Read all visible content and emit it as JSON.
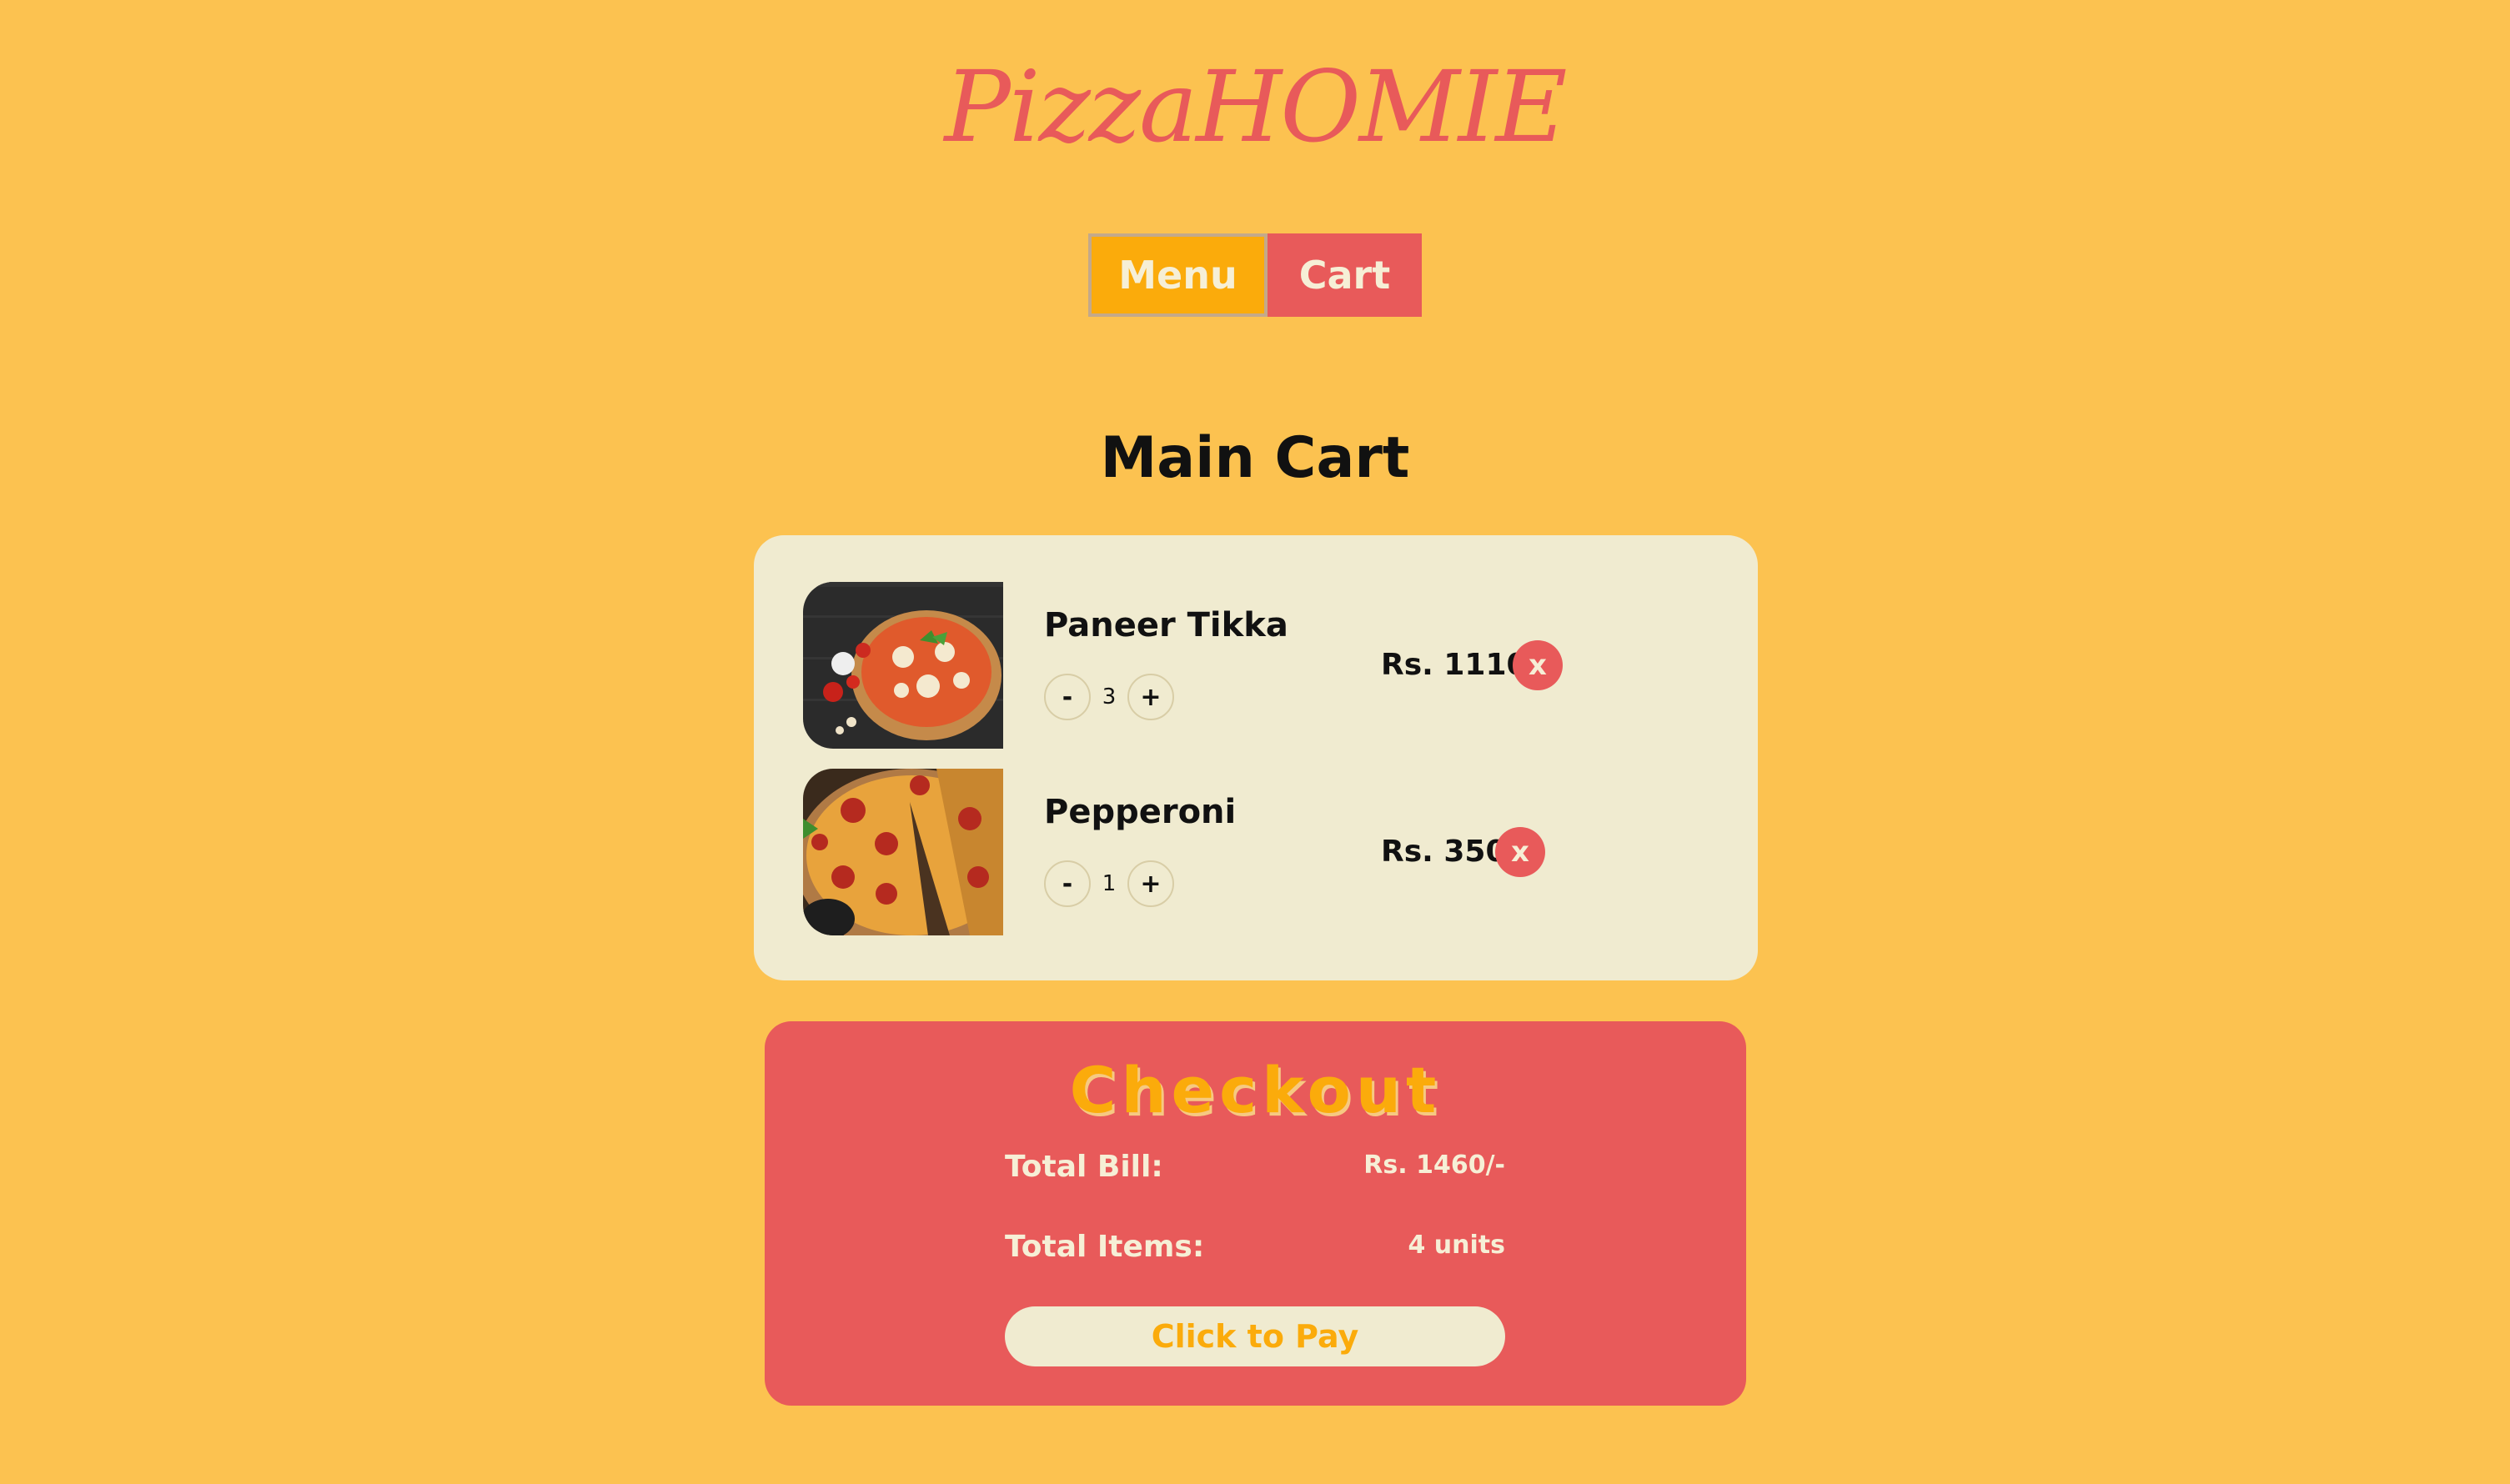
{
  "brand": {
    "title": "PizzaHOMIE"
  },
  "nav": {
    "menu_label": "Menu",
    "cart_label": "Cart"
  },
  "cart": {
    "title": "Main Cart",
    "items": [
      {
        "name": "Paneer Tikka",
        "quantity": "3",
        "price": "Rs. 1110",
        "decrement_label": "-",
        "increment_label": "+",
        "remove_label": "x"
      },
      {
        "name": "Pepperoni",
        "quantity": "1",
        "price": "Rs. 350",
        "decrement_label": "-",
        "increment_label": "+",
        "remove_label": "x"
      }
    ]
  },
  "checkout": {
    "title": "Checkout",
    "total_bill_label": "Total Bill:",
    "total_bill_value": "Rs. 1460/-",
    "total_items_label": "Total Items:",
    "total_items_value": "4 units",
    "pay_label": "Click to Pay"
  },
  "colors": {
    "background": "#fcc250",
    "accent_red": "#e85a5a",
    "accent_orange": "#fbab0b",
    "card_cream": "#f0ebd0"
  },
  "icons": {
    "item_1_image": "pizza-image",
    "item_2_image": "pizza-image"
  }
}
